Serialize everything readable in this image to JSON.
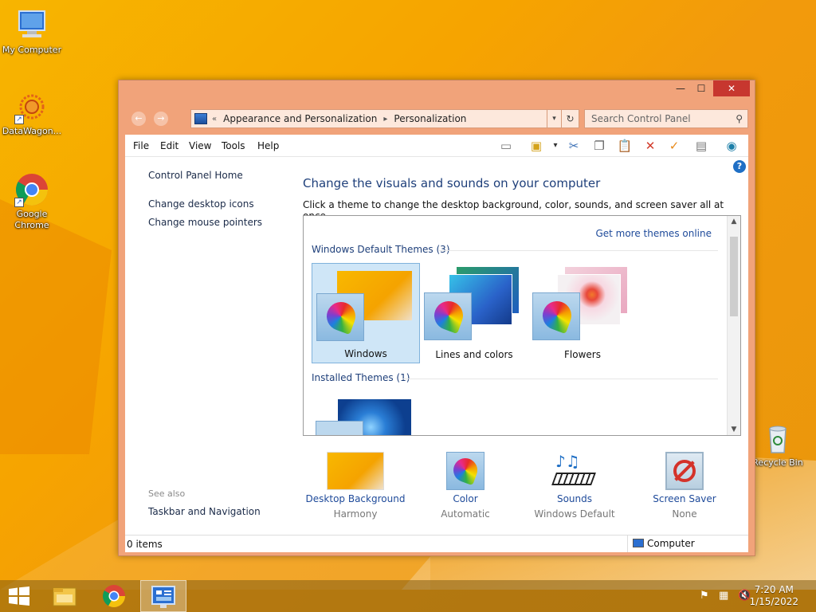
{
  "desktop": {
    "icons": [
      {
        "label": "My Computer"
      },
      {
        "label": "DataWagon..."
      },
      {
        "label": "Google Chrome"
      },
      {
        "label": "Recycle Bin"
      }
    ]
  },
  "window": {
    "address": {
      "overflow": "«",
      "segments": [
        "Appearance and Personalization",
        "Personalization"
      ]
    },
    "search_placeholder": "Search Control Panel",
    "menu": [
      "File",
      "Edit",
      "View",
      "Tools",
      "Help"
    ],
    "toolbar_icons": [
      "layout-icon",
      "folder-options-icon",
      "cut-icon",
      "copy-icon",
      "paste-icon",
      "delete-icon",
      "undo-check-icon",
      "properties-icon",
      "globe-icon"
    ],
    "left_pane": {
      "home": "Control Panel Home",
      "links": [
        "Change desktop icons",
        "Change mouse pointers"
      ],
      "see_also_label": "See also",
      "see_also_links": [
        "Taskbar and Navigation"
      ]
    },
    "title": "Change the visuals and sounds on your computer",
    "description": "Click a theme to change the desktop background, color, sounds, and screen saver all at once.",
    "more_themes_link": "Get more themes online",
    "groups": [
      {
        "heading": "Windows Default Themes (3)",
        "themes": [
          {
            "name": "Windows",
            "selected": true
          },
          {
            "name": "Lines and colors",
            "selected": false
          },
          {
            "name": "Flowers",
            "selected": false
          }
        ]
      },
      {
        "heading": "Installed Themes (1)",
        "themes": []
      }
    ],
    "bottom": [
      {
        "link": "Desktop Background",
        "value": "Harmony"
      },
      {
        "link": "Color",
        "value": "Automatic"
      },
      {
        "link": "Sounds",
        "value": "Windows Default"
      },
      {
        "link": "Screen Saver",
        "value": "None"
      }
    ],
    "status": {
      "items": "0 items",
      "location": "Computer"
    }
  },
  "taskbar": {
    "time": "7:20 AM",
    "date": "1/15/2022"
  },
  "colors": {
    "accent_link": "#1e4a9a",
    "title_blue": "#1e3f7a",
    "window_frame": "#f1a37a",
    "close_red": "#c7372f"
  }
}
